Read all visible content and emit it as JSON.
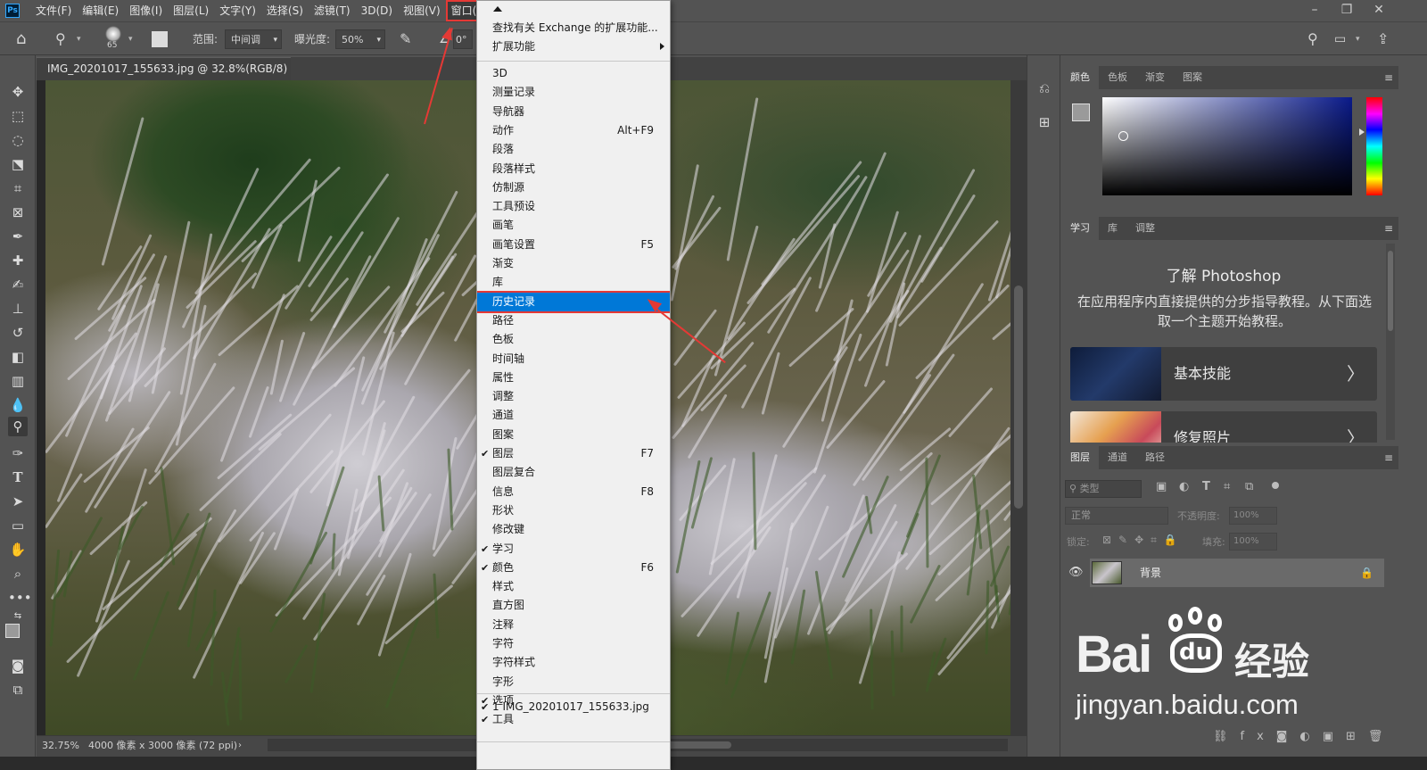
{
  "menubar": {
    "logo": "Ps",
    "items": [
      "文件(F)",
      "编辑(E)",
      "图像(I)",
      "图层(L)",
      "文字(Y)",
      "选择(S)",
      "滤镜(T)",
      "3D(D)",
      "视图(V)",
      "窗口(W)"
    ],
    "active_index": 9,
    "window_controls": [
      "–",
      "❐",
      "✕"
    ]
  },
  "options": {
    "brush_size": "65",
    "range_label": "范围:",
    "range_value": "中间调",
    "exposure_label": "曝光度:",
    "exposure_value": "50%",
    "angle_value": "0°"
  },
  "document": {
    "tab_title": "IMG_20201017_155633.jpg @ 32.8%(RGB/8) *",
    "close": "×",
    "zoom": "32.75%",
    "dimensions": "4000 像素 x 3000 像素 (72 ppi)"
  },
  "window_menu": {
    "items": [
      {
        "label": "查找有关 Exchange 的扩展功能...",
        "shortcut": "",
        "checked": false
      },
      {
        "label": "扩展功能",
        "shortcut": "",
        "checked": false,
        "submenu": true
      },
      {
        "label": "3D",
        "shortcut": "",
        "checked": false
      },
      {
        "label": "测量记录",
        "shortcut": "",
        "checked": false
      },
      {
        "label": "导航器",
        "shortcut": "",
        "checked": false
      },
      {
        "label": "动作",
        "shortcut": "Alt+F9",
        "checked": false
      },
      {
        "label": "段落",
        "shortcut": "",
        "checked": false
      },
      {
        "label": "段落样式",
        "shortcut": "",
        "checked": false
      },
      {
        "label": "仿制源",
        "shortcut": "",
        "checked": false
      },
      {
        "label": "工具预设",
        "shortcut": "",
        "checked": false
      },
      {
        "label": "画笔",
        "shortcut": "",
        "checked": false
      },
      {
        "label": "画笔设置",
        "shortcut": "F5",
        "checked": false
      },
      {
        "label": "渐变",
        "shortcut": "",
        "checked": false
      },
      {
        "label": "库",
        "shortcut": "",
        "checked": false
      },
      {
        "label": "历史记录",
        "shortcut": "",
        "checked": false,
        "highlighted": true
      },
      {
        "label": "路径",
        "shortcut": "",
        "checked": false
      },
      {
        "label": "色板",
        "shortcut": "",
        "checked": false
      },
      {
        "label": "时间轴",
        "shortcut": "",
        "checked": false
      },
      {
        "label": "属性",
        "shortcut": "",
        "checked": false
      },
      {
        "label": "调整",
        "shortcut": "",
        "checked": false
      },
      {
        "label": "通道",
        "shortcut": "",
        "checked": false
      },
      {
        "label": "图案",
        "shortcut": "",
        "checked": false
      },
      {
        "label": "图层",
        "shortcut": "F7",
        "checked": true
      },
      {
        "label": "图层复合",
        "shortcut": "",
        "checked": false
      },
      {
        "label": "信息",
        "shortcut": "F8",
        "checked": false
      },
      {
        "label": "形状",
        "shortcut": "",
        "checked": false
      },
      {
        "label": "修改键",
        "shortcut": "",
        "checked": false
      },
      {
        "label": "学习",
        "shortcut": "",
        "checked": true
      },
      {
        "label": "颜色",
        "shortcut": "F6",
        "checked": true
      },
      {
        "label": "样式",
        "shortcut": "",
        "checked": false
      },
      {
        "label": "直方图",
        "shortcut": "",
        "checked": false
      },
      {
        "label": "注释",
        "shortcut": "",
        "checked": false
      },
      {
        "label": "字符",
        "shortcut": "",
        "checked": false
      },
      {
        "label": "字符样式",
        "shortcut": "",
        "checked": false
      },
      {
        "label": "字形",
        "shortcut": "",
        "checked": false
      },
      {
        "label": "选项",
        "shortcut": "",
        "checked": true
      },
      {
        "label": "工具",
        "shortcut": "",
        "checked": true
      },
      {
        "label": "1 IMG_20201017_155633.jpg",
        "shortcut": "",
        "checked": true
      }
    ],
    "check_glyph": "✔"
  },
  "color_panel": {
    "tabs": [
      "颜色",
      "色板",
      "渐变",
      "图案"
    ],
    "active": 0,
    "hue_color": "#0a1a8a"
  },
  "learn_panel": {
    "tabs": [
      "学习",
      "库",
      "调整"
    ],
    "active": 0,
    "title": "了解 Photoshop",
    "description": "在应用程序内直接提供的分步指导教程。从下面选取一个主题开始教程。",
    "cards": [
      {
        "label": "基本技能",
        "arrow": "〉"
      },
      {
        "label": "修复照片",
        "arrow": "〉"
      }
    ]
  },
  "layers_panel": {
    "tabs": [
      "图层",
      "通道",
      "路径"
    ],
    "active": 0,
    "filter_placeholder": "类型",
    "blend_mode": "正常",
    "opacity_label": "不透明度:",
    "opacity_value": "100%",
    "lock_label": "锁定:",
    "fill_label": "填充:",
    "fill_value": "100%",
    "layers": [
      {
        "name": "背景",
        "visible": true,
        "locked": true
      }
    ]
  },
  "watermark": {
    "brand": "Bai",
    "paw": "du",
    "cn": "经验",
    "url": "jingyan.baidu.com"
  },
  "colors": {
    "highlight": "#0078d7",
    "annotation": "#e53935"
  }
}
